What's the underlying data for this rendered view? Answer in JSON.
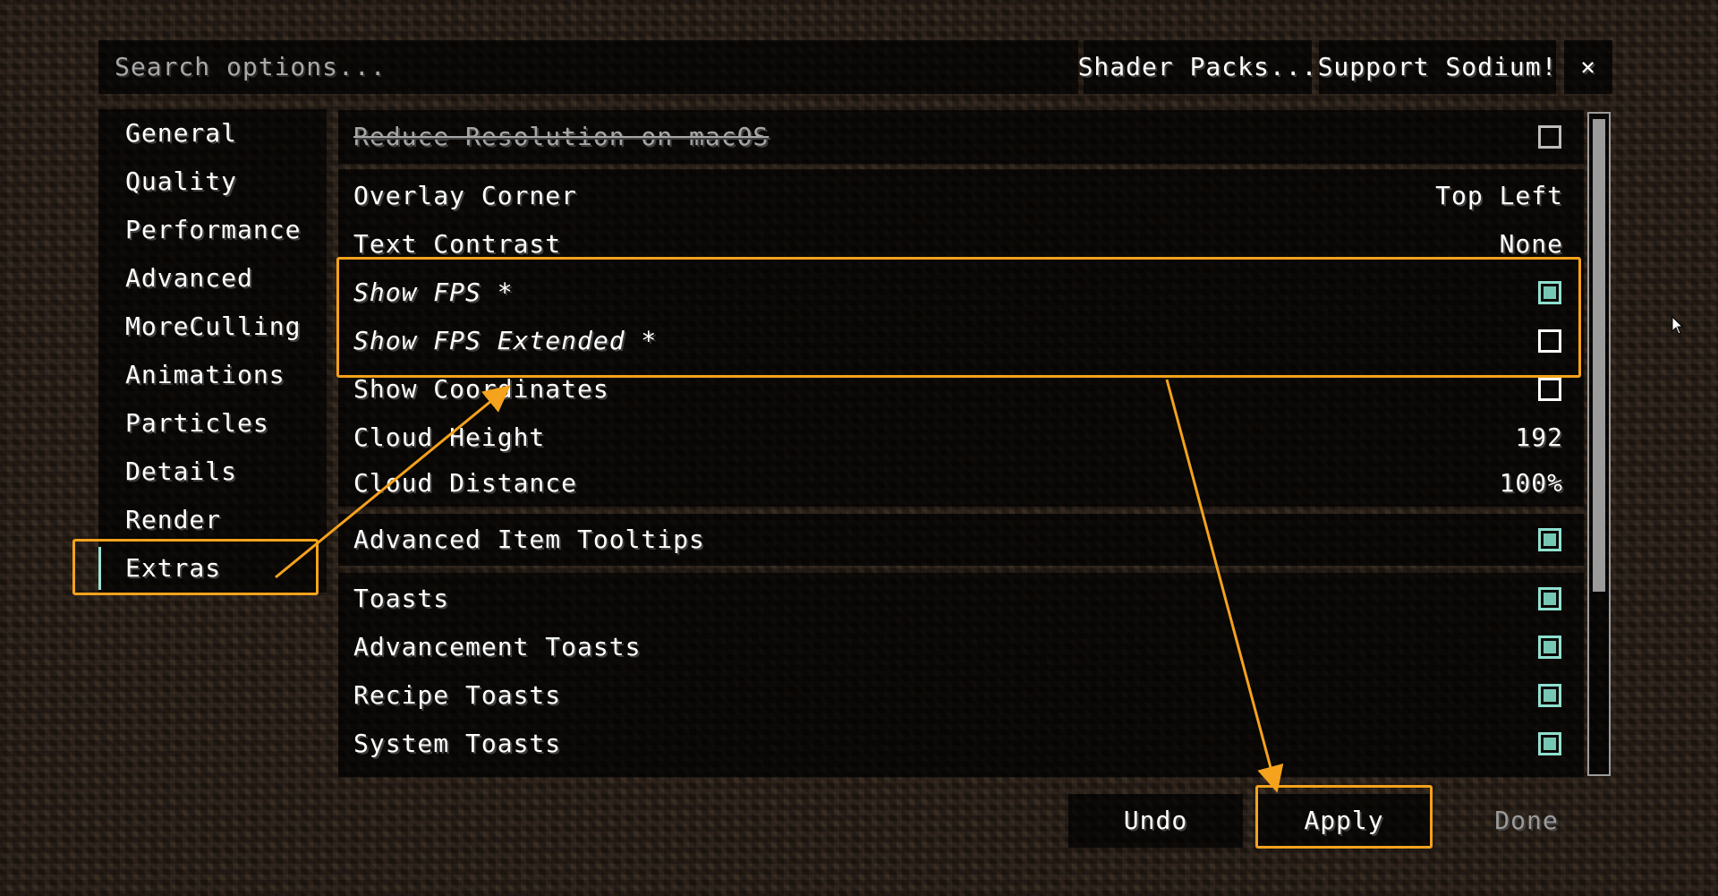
{
  "search": {
    "placeholder": "Search options..."
  },
  "toolbar": {
    "shader_packs": "Shader Packs...",
    "support": "Support Sodium!",
    "close": "×"
  },
  "sidebar": {
    "items": [
      {
        "label": "General"
      },
      {
        "label": "Quality"
      },
      {
        "label": "Performance"
      },
      {
        "label": "Advanced"
      },
      {
        "label": "MoreCulling"
      },
      {
        "label": "Animations"
      },
      {
        "label": "Particles"
      },
      {
        "label": "Details"
      },
      {
        "label": "Render"
      },
      {
        "label": "Extras",
        "selected": true
      }
    ]
  },
  "options": {
    "reduce_resolution": {
      "label": "Reduce Resolution on macOS",
      "checked": false,
      "disabled": true
    },
    "overlay_corner": {
      "label": "Overlay Corner",
      "value": "Top Left"
    },
    "text_contrast": {
      "label": "Text Contrast",
      "value": "None"
    },
    "show_fps": {
      "label": "Show FPS *",
      "checked": true,
      "modified": true
    },
    "show_fps_extended": {
      "label": "Show FPS Extended *",
      "checked": false,
      "modified": true
    },
    "show_coordinates": {
      "label": "Show Coordinates",
      "checked": false
    },
    "cloud_height": {
      "label": "Cloud Height",
      "value": "192"
    },
    "cloud_distance": {
      "label": "Cloud Distance",
      "value": "100%"
    },
    "advanced_item_tooltips": {
      "label": "Advanced Item Tooltips",
      "checked": true
    },
    "toasts": {
      "label": "Toasts",
      "checked": true
    },
    "advancement_toasts": {
      "label": "Advancement Toasts",
      "checked": true
    },
    "recipe_toasts": {
      "label": "Recipe Toasts",
      "checked": true
    },
    "system_toasts": {
      "label": "System Toasts",
      "checked": true
    }
  },
  "buttons": {
    "undo": "Undo",
    "apply": "Apply",
    "done": "Done"
  },
  "colors": {
    "annotation": "#f5a21c",
    "checkbox_on": "#76c8b5",
    "selected_indicator": "#9be3d4"
  }
}
